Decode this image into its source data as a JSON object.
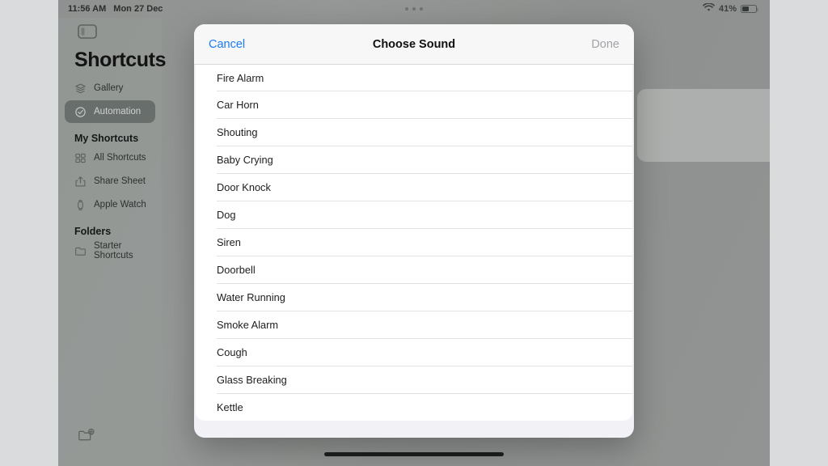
{
  "status_bar": {
    "time": "11:56 AM",
    "date": "Mon 27 Dec",
    "battery_percent": "41%",
    "wifi_icon": "wifi-icon",
    "battery_icon": "battery-icon",
    "multitask_icon": "multitask-dots-icon"
  },
  "sidebar": {
    "toggle_icon": "sidebar-toggle-icon",
    "title": "Shortcuts",
    "new_folder_icon": "new-folder-icon",
    "top_items": [
      {
        "label": "Gallery",
        "icon": "gallery-layers-icon",
        "selected": false
      },
      {
        "label": "Automation",
        "icon": "automation-clock-icon",
        "selected": true
      }
    ],
    "sections": [
      {
        "header": "My Shortcuts",
        "items": [
          {
            "label": "All Shortcuts",
            "icon": "grid-icon"
          },
          {
            "label": "Share Sheet",
            "icon": "share-icon"
          },
          {
            "label": "Apple Watch",
            "icon": "watch-icon"
          }
        ]
      },
      {
        "header": "Folders",
        "items": [
          {
            "label": "Starter Shortcuts",
            "icon": "folder-icon"
          }
        ]
      }
    ]
  },
  "background_card": {
    "chevron_icon": "chevron-right-icon"
  },
  "modal": {
    "cancel_label": "Cancel",
    "title": "Choose Sound",
    "done_label": "Done",
    "done_enabled": false,
    "sounds": [
      "Fire Alarm",
      "Car Horn",
      "Shouting",
      "Baby Crying",
      "Door Knock",
      "Dog",
      "Siren",
      "Doorbell",
      "Water Running",
      "Smoke Alarm",
      "Cough",
      "Glass Breaking",
      "Kettle"
    ]
  },
  "colors": {
    "accent_blue": "#1a7bf2",
    "disabled_gray": "#a3a3a8",
    "sheet_bg": "#f2f2f6",
    "row_bg": "#ffffff",
    "separator": "#e3e3e6"
  }
}
